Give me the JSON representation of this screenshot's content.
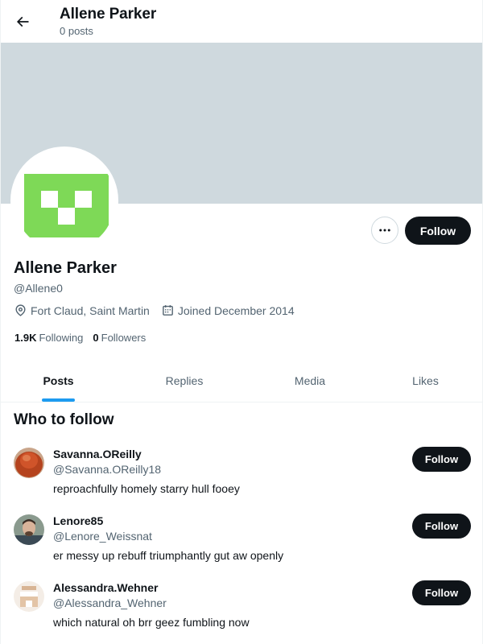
{
  "header": {
    "title": "Allene Parker",
    "post_count": "0 posts"
  },
  "profile": {
    "name": "Allene Parker",
    "handle": "@Allene0",
    "location": "Fort Claud, Saint Martin",
    "joined": "Joined December 2014",
    "following_count": "1.9K",
    "following_label": "Following",
    "followers_count": "0",
    "followers_label": "Followers",
    "follow_label": "Follow",
    "avatar_color": "#7ed957",
    "banner_color": "#cfd9de"
  },
  "tabs": [
    {
      "label": "Posts",
      "active": true
    },
    {
      "label": "Replies",
      "active": false
    },
    {
      "label": "Media",
      "active": false
    },
    {
      "label": "Likes",
      "active": false
    }
  ],
  "who_to_follow": {
    "title": "Who to follow",
    "items": [
      {
        "name": "Savanna.OReilly",
        "handle": "@Savanna.OReilly18",
        "bio": "reproachfully homely starry hull fooey",
        "follow_label": "Follow"
      },
      {
        "name": "Lenore85",
        "handle": "@Lenore_Weissnat",
        "bio": "er messy up rebuff triumphantly gut aw openly",
        "follow_label": "Follow"
      },
      {
        "name": "Alessandra.Wehner",
        "handle": "@Alessandra_Wehner",
        "bio": "which natural oh brr geez fumbling now",
        "follow_label": "Follow"
      }
    ]
  },
  "colors": {
    "accent": "#1d9bf0",
    "text_primary": "#0f1419",
    "text_secondary": "#536471",
    "button_dark": "#0f1419"
  }
}
